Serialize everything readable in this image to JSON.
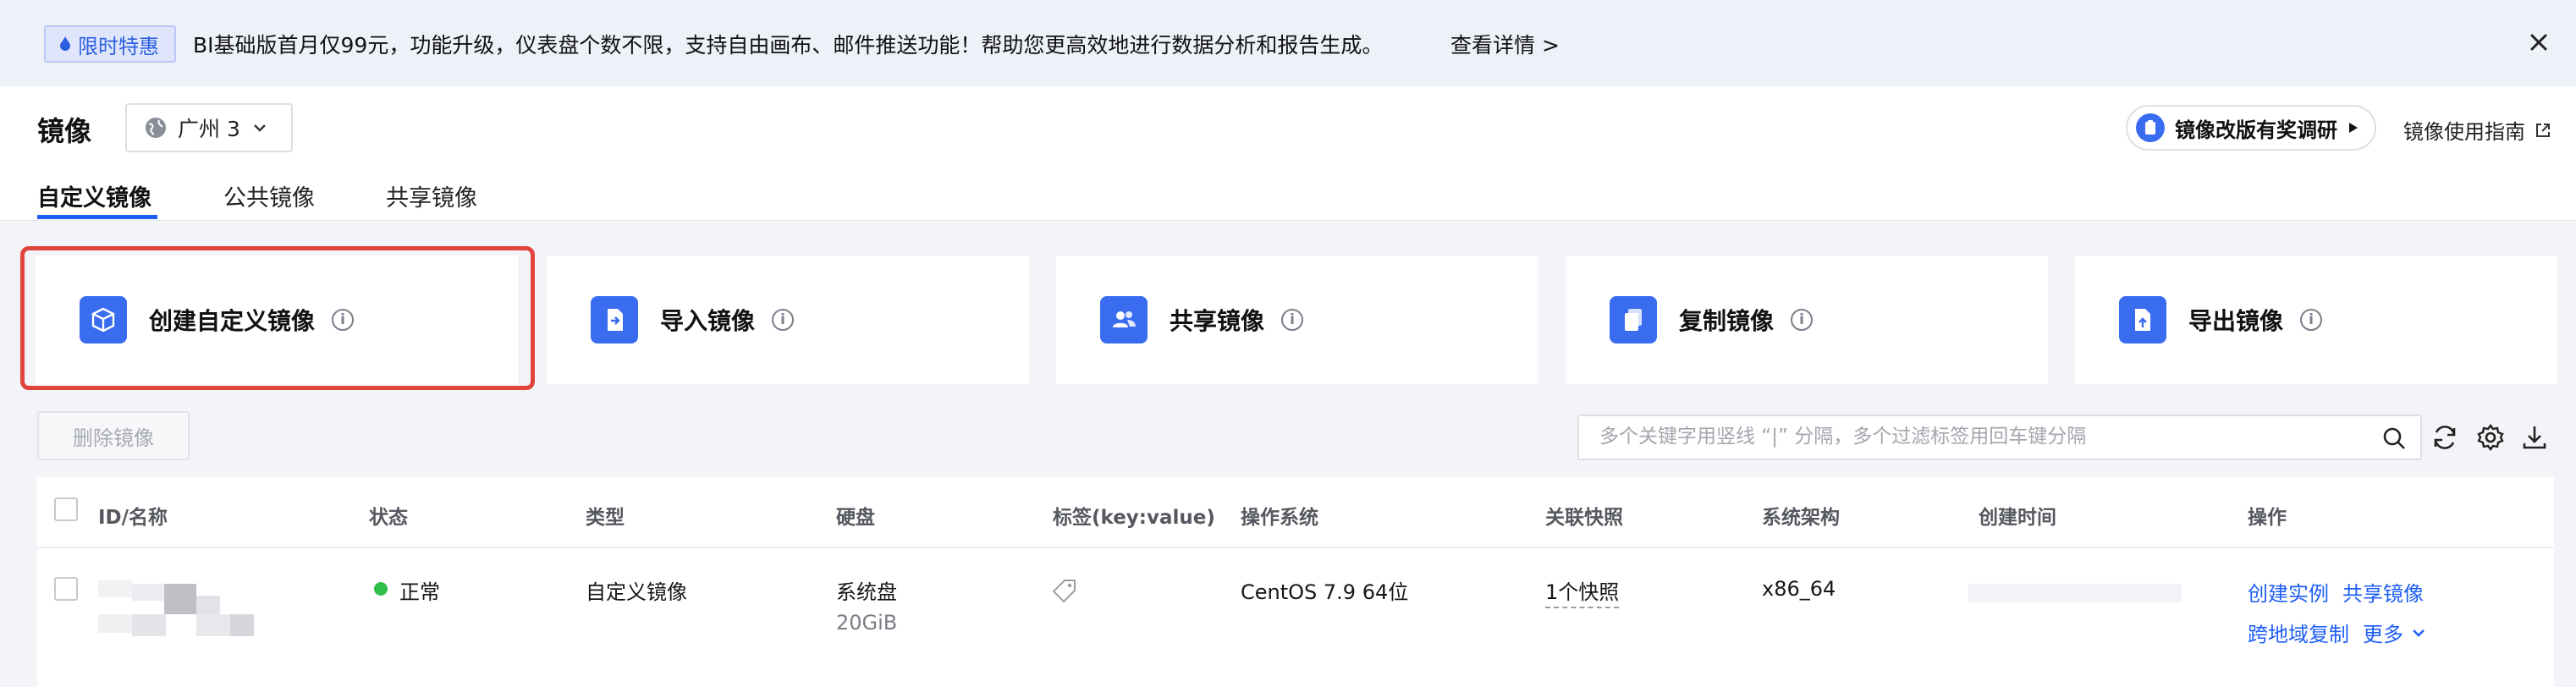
{
  "banner": {
    "tag_label": "限时特惠",
    "text": "BI基础版首月仅99元，功能升级，仪表盘个数不限，支持自由画布、邮件推送功能！帮助您更高效地进行数据分析和报告生成。",
    "link_label": "查看详情 >"
  },
  "header": {
    "title": "镜像",
    "region": "广州 3",
    "survey_label": "镜像改版有奖调研",
    "guide_label": "镜像使用指南"
  },
  "tabs": [
    {
      "label": "自定义镜像",
      "active": true
    },
    {
      "label": "公共镜像",
      "active": false
    },
    {
      "label": "共享镜像",
      "active": false
    }
  ],
  "cards": [
    {
      "label": "创建自定义镜像",
      "icon": "cube-icon"
    },
    {
      "label": "导入镜像",
      "icon": "import-icon"
    },
    {
      "label": "共享镜像",
      "icon": "users-icon"
    },
    {
      "label": "复制镜像",
      "icon": "copy-icon"
    },
    {
      "label": "导出镜像",
      "icon": "export-icon"
    }
  ],
  "toolbar": {
    "delete_label": "删除镜像",
    "search_placeholder": "多个关键字用竖线 “|” 分隔，多个过滤标签用回车键分隔"
  },
  "table": {
    "columns": [
      "ID/名称",
      "状态",
      "类型",
      "硬盘",
      "标签(key:value)",
      "操作系统",
      "关联快照",
      "系统架构",
      "创建时间",
      "操作"
    ],
    "rows": [
      {
        "status": "正常",
        "type": "自定义镜像",
        "disk_name": "系统盘",
        "disk_size": "20GiB",
        "os": "CentOS 7.9 64位",
        "snapshot": "1个快照",
        "arch": "x86_64",
        "actions": [
          "创建实例",
          "共享镜像",
          "跨地域复制",
          "更多"
        ]
      }
    ]
  },
  "colors": {
    "accent": "#1e5ef5",
    "status_ok": "#2fbf48",
    "highlight": "#e1443c",
    "icon_bg": "#3a6cf0"
  }
}
